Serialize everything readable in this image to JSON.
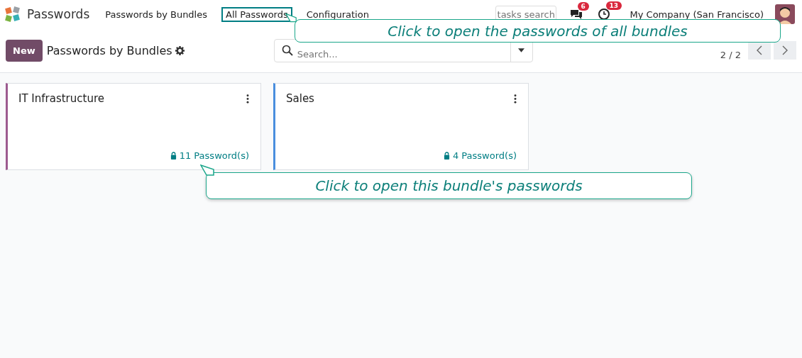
{
  "navbar": {
    "app_name": "Passwords",
    "menu": [
      {
        "label": "Passwords by Bundles",
        "selected": false
      },
      {
        "label": "All Passwords",
        "selected": true
      },
      {
        "label": "Configuration",
        "selected": false
      }
    ],
    "search": {
      "placeholder": "tasks search"
    },
    "messages_badge": "6",
    "activities_badge": "13",
    "company": "My Company (San Francisco)"
  },
  "control_panel": {
    "new_button": "New",
    "breadcrumb": "Passwords by Bundles",
    "search": {
      "placeholder": "Search..."
    },
    "pager": "2 / 2"
  },
  "bundles": [
    {
      "name": "IT Infrastructure",
      "count": "11 Password(s)",
      "color": "#9c5a8f"
    },
    {
      "name": "Sales",
      "count": "4 Password(s)",
      "color": "#4a8ede"
    }
  ],
  "callouts": [
    {
      "text": "Click to open the passwords of all bundles"
    },
    {
      "text": "Click to open this bundle's passwords"
    }
  ]
}
